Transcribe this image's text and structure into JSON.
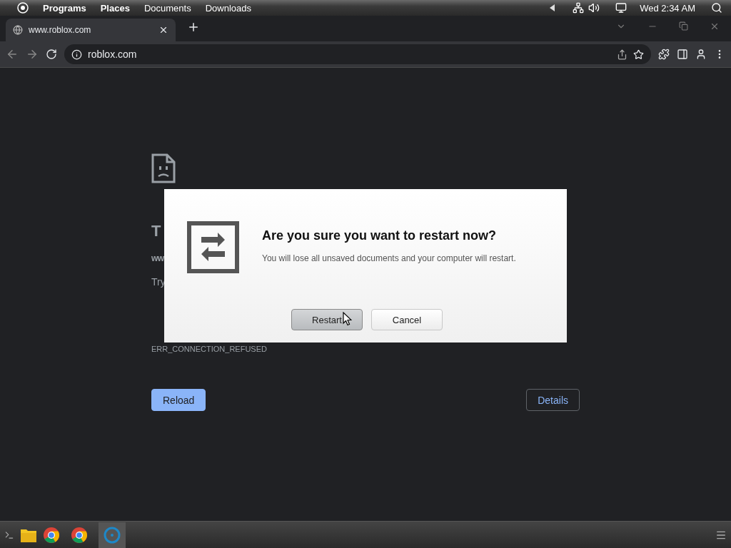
{
  "top_panel": {
    "menus": [
      {
        "label": "Programs",
        "bold": true
      },
      {
        "label": "Places",
        "bold": true
      },
      {
        "label": "Documents",
        "bold": false
      },
      {
        "label": "Downloads",
        "bold": false
      }
    ],
    "clock": "Wed 2:34 AM"
  },
  "browser": {
    "tab": {
      "title": "www.roblox.com"
    },
    "address": "roblox.com"
  },
  "error_page": {
    "title": "T",
    "url": "ww",
    "hint": "Try",
    "code": "ERR_CONNECTION_REFUSED",
    "buttons": [
      {
        "label": "Reload",
        "kind": "primary"
      },
      {
        "label": "Details",
        "kind": "outline"
      }
    ]
  },
  "dialog": {
    "title": "Are you sure you want to restart now?",
    "message": "You will lose all unsaved documents and your computer will restart.",
    "buttons": [
      {
        "label": "Restart",
        "selected": true
      },
      {
        "label": "Cancel",
        "selected": false
      }
    ]
  }
}
